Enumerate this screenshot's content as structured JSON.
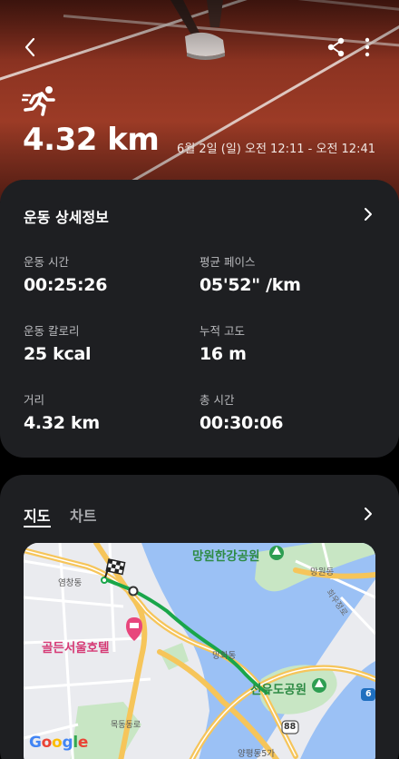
{
  "header": {
    "back_icon": "chevron-left-icon",
    "share_icon": "share-icon",
    "more_icon": "more-vertical-icon",
    "activity_icon": "running-icon",
    "distance": "4.32 km",
    "date_range": "6월 2일 (일) 오전 12:11 - 오전 12:41"
  },
  "details": {
    "title": "운동 상세정보",
    "stats": [
      {
        "label": "운동 시간",
        "value": "00:25:26"
      },
      {
        "label": "평균 페이스",
        "value": "05'52\" /km"
      },
      {
        "label": "운동 칼로리",
        "value": "25 kcal"
      },
      {
        "label": "누적 고도",
        "value": "16 m"
      },
      {
        "label": "거리",
        "value": "4.32 km"
      },
      {
        "label": "총 시간",
        "value": "00:30:06"
      }
    ]
  },
  "map_card": {
    "tabs": [
      "지도",
      "차트"
    ],
    "active_tab": "지도",
    "map_labels": {
      "park1": "망원한강공원",
      "park2": "선유도공원",
      "hotel": "골든서울호텔",
      "district1": "염창동",
      "district2": "망원동",
      "district3": "망화동",
      "district4": "목동동로",
      "district5": "양평동5가",
      "road1": "희우정로",
      "route_badge": "88",
      "route_badge2": "6",
      "logo": "Google"
    },
    "colors": {
      "water": "#9bc1f5",
      "land": "#eaebef",
      "park": "#c8e6c4",
      "highway": "#f6c55a",
      "route": "#1aa64a"
    }
  }
}
